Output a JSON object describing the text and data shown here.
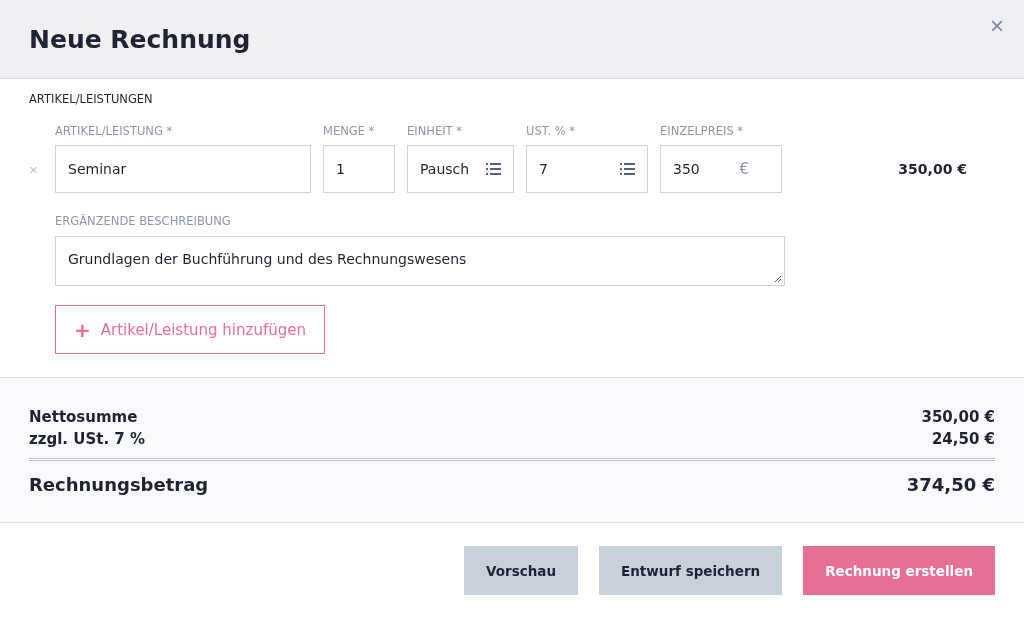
{
  "dialog": {
    "title": "Neue Rechnung",
    "close": "×"
  },
  "section_title": "ARTIKEL/LEISTUNGEN",
  "line_item": {
    "remove": "×",
    "fields": [
      {
        "label": "ARTIKEL/LEISTUNG *",
        "value": "Seminar",
        "kind": "text"
      },
      {
        "label": "MENGE *",
        "value": "1",
        "kind": "text"
      },
      {
        "label": "EINHEIT *",
        "value": "Pausch",
        "kind": "select"
      },
      {
        "label": "UST. % *",
        "value": "7",
        "kind": "select"
      },
      {
        "label": "EINZELPREIS *",
        "value": "350",
        "kind": "currency",
        "suffix": "€"
      }
    ],
    "line_total": "350,00 €",
    "description_label": "ERGÄNZENDE BESCHREIBUNG",
    "description": "Grundlagen der Buchführung und des Rechnungswesens"
  },
  "add_button": {
    "icon": "+",
    "label": "Artikel/Leistung hinzufügen"
  },
  "totals": [
    {
      "label": "Nettosumme",
      "value": "350,00 €"
    },
    {
      "label": "zzgl. USt. 7 %",
      "value": "24,50 €"
    }
  ],
  "grand_total": {
    "label": "Rechnungsbetrag",
    "value": "374,50 €"
  },
  "buttons": [
    {
      "label": "Vorschau",
      "kind": "secondary"
    },
    {
      "label": "Entwurf speichern",
      "kind": "secondary"
    },
    {
      "label": "Rechnung erstellen",
      "kind": "primary"
    }
  ]
}
